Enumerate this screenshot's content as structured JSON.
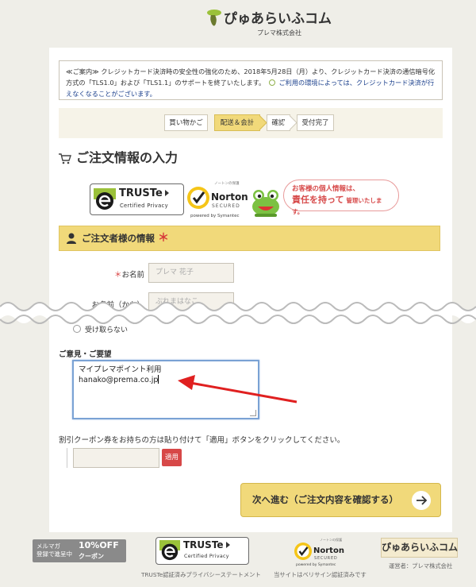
{
  "header": {
    "logo_text": "ぴゅあらいふコム",
    "company": "プレマ株式会社"
  },
  "notice": {
    "part1": "≪ご案内≫ クレジットカード決済時の安全性の強化のため、2018年5月28日（月）より、クレジットカード決済の通信暗号化方式の「TLS1.0」および「TLS1.1」のサポートを終了いたします。",
    "part2": "ご利用の環境によっては、クレジットカード決済が行えなくなることがございます。"
  },
  "steps": [
    "買い物かご",
    "配送＆会計",
    "確認",
    "受付完了"
  ],
  "page_title": "ご注文情報の入力",
  "badges": {
    "truste_name": "TRUSTe",
    "truste_sub": "Certified Privacy",
    "norton_top": "ノートンの保護",
    "norton_name": "Norton",
    "norton_secured": "SECURED",
    "norton_by": "powered by Symantec"
  },
  "bubble": {
    "line1": "お客様の個人情報は、",
    "line2_big": "責任を持って",
    "line2_small": "管理いたします。"
  },
  "section": {
    "title": "ご注文者様の情報",
    "required_mark": "＊"
  },
  "form": {
    "name_label": "お名前",
    "name_placeholder": "プレマ 花子",
    "kana_label": "お名前（かな）",
    "kana_placeholder": "ぷれまはなこ",
    "radio_label": "受け取らない",
    "opinion_label": "ご意見・ご要望",
    "opinion_line1": "マイプレマポイント利用",
    "opinion_line2": "hanako@prema.co.jp",
    "coupon_label": "割引クーポン券をお持ちの方は貼り付けて「適用」ボタンをクリックしてください。",
    "apply_label": "適用"
  },
  "next_button": "次へ進む（ご注文内容を確認する）",
  "footer": {
    "mailmag_line1": "メルマガ",
    "mailmag_line2": "登録で進呈中",
    "mailmag_pct": "10%OFF",
    "mailmag_coupon": "クーポン",
    "truste_caption": "TRUSTe認証済みプライバシーステートメント",
    "norton_caption": "当サイトはベリサイン認証済みです",
    "operator_caption": "運営者：プレマ株式会社",
    "logo_text": "ぴゅあらいふコム"
  },
  "colors": {
    "accent_yellow": "#f1d97a",
    "required_red": "#d73a3a",
    "apply_red": "#d74848",
    "arrow_red": "#e02020"
  }
}
